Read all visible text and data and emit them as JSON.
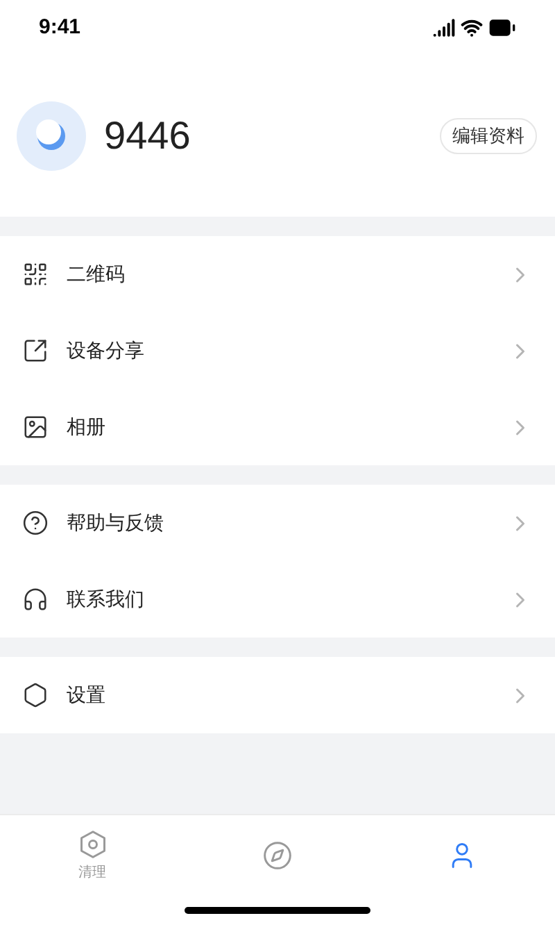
{
  "status_bar": {
    "time": "9:41"
  },
  "profile": {
    "name": "9446",
    "edit_button": "编辑资料"
  },
  "menu_groups": [
    {
      "items": [
        {
          "kind": "qrcode",
          "label": "二维码"
        },
        {
          "kind": "share",
          "label": "设备分享"
        },
        {
          "kind": "album",
          "label": "相册"
        }
      ]
    },
    {
      "items": [
        {
          "kind": "help",
          "label": "帮助与反馈"
        },
        {
          "kind": "contact",
          "label": "联系我们"
        }
      ]
    },
    {
      "items": [
        {
          "kind": "settings",
          "label": "设置"
        }
      ]
    }
  ],
  "tab_bar": [
    {
      "kind": "camera",
      "label": "清理",
      "selected": false
    },
    {
      "kind": "compass",
      "selected": false
    },
    {
      "kind": "person",
      "selected": true
    }
  ]
}
